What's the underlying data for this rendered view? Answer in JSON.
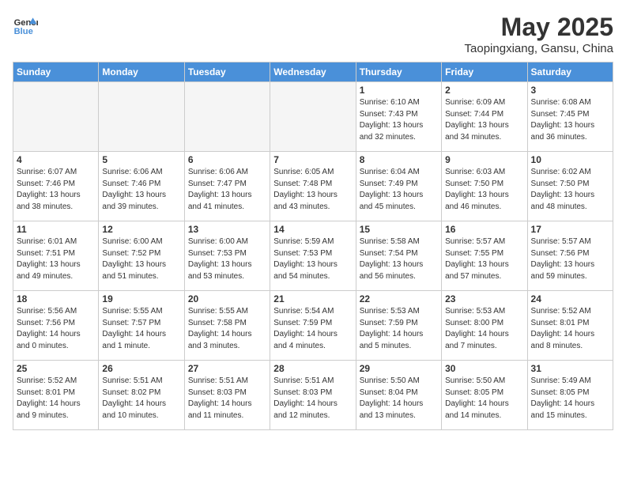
{
  "header": {
    "logo_general": "General",
    "logo_blue": "Blue",
    "month": "May 2025",
    "location": "Taopingxiang, Gansu, China"
  },
  "days_of_week": [
    "Sunday",
    "Monday",
    "Tuesday",
    "Wednesday",
    "Thursday",
    "Friday",
    "Saturday"
  ],
  "weeks": [
    [
      {
        "day": "",
        "info": ""
      },
      {
        "day": "",
        "info": ""
      },
      {
        "day": "",
        "info": ""
      },
      {
        "day": "",
        "info": ""
      },
      {
        "day": "1",
        "info": "Sunrise: 6:10 AM\nSunset: 7:43 PM\nDaylight: 13 hours\nand 32 minutes."
      },
      {
        "day": "2",
        "info": "Sunrise: 6:09 AM\nSunset: 7:44 PM\nDaylight: 13 hours\nand 34 minutes."
      },
      {
        "day": "3",
        "info": "Sunrise: 6:08 AM\nSunset: 7:45 PM\nDaylight: 13 hours\nand 36 minutes."
      }
    ],
    [
      {
        "day": "4",
        "info": "Sunrise: 6:07 AM\nSunset: 7:46 PM\nDaylight: 13 hours\nand 38 minutes."
      },
      {
        "day": "5",
        "info": "Sunrise: 6:06 AM\nSunset: 7:46 PM\nDaylight: 13 hours\nand 39 minutes."
      },
      {
        "day": "6",
        "info": "Sunrise: 6:06 AM\nSunset: 7:47 PM\nDaylight: 13 hours\nand 41 minutes."
      },
      {
        "day": "7",
        "info": "Sunrise: 6:05 AM\nSunset: 7:48 PM\nDaylight: 13 hours\nand 43 minutes."
      },
      {
        "day": "8",
        "info": "Sunrise: 6:04 AM\nSunset: 7:49 PM\nDaylight: 13 hours\nand 45 minutes."
      },
      {
        "day": "9",
        "info": "Sunrise: 6:03 AM\nSunset: 7:50 PM\nDaylight: 13 hours\nand 46 minutes."
      },
      {
        "day": "10",
        "info": "Sunrise: 6:02 AM\nSunset: 7:50 PM\nDaylight: 13 hours\nand 48 minutes."
      }
    ],
    [
      {
        "day": "11",
        "info": "Sunrise: 6:01 AM\nSunset: 7:51 PM\nDaylight: 13 hours\nand 49 minutes."
      },
      {
        "day": "12",
        "info": "Sunrise: 6:00 AM\nSunset: 7:52 PM\nDaylight: 13 hours\nand 51 minutes."
      },
      {
        "day": "13",
        "info": "Sunrise: 6:00 AM\nSunset: 7:53 PM\nDaylight: 13 hours\nand 53 minutes."
      },
      {
        "day": "14",
        "info": "Sunrise: 5:59 AM\nSunset: 7:53 PM\nDaylight: 13 hours\nand 54 minutes."
      },
      {
        "day": "15",
        "info": "Sunrise: 5:58 AM\nSunset: 7:54 PM\nDaylight: 13 hours\nand 56 minutes."
      },
      {
        "day": "16",
        "info": "Sunrise: 5:57 AM\nSunset: 7:55 PM\nDaylight: 13 hours\nand 57 minutes."
      },
      {
        "day": "17",
        "info": "Sunrise: 5:57 AM\nSunset: 7:56 PM\nDaylight: 13 hours\nand 59 minutes."
      }
    ],
    [
      {
        "day": "18",
        "info": "Sunrise: 5:56 AM\nSunset: 7:56 PM\nDaylight: 14 hours\nand 0 minutes."
      },
      {
        "day": "19",
        "info": "Sunrise: 5:55 AM\nSunset: 7:57 PM\nDaylight: 14 hours\nand 1 minute."
      },
      {
        "day": "20",
        "info": "Sunrise: 5:55 AM\nSunset: 7:58 PM\nDaylight: 14 hours\nand 3 minutes."
      },
      {
        "day": "21",
        "info": "Sunrise: 5:54 AM\nSunset: 7:59 PM\nDaylight: 14 hours\nand 4 minutes."
      },
      {
        "day": "22",
        "info": "Sunrise: 5:53 AM\nSunset: 7:59 PM\nDaylight: 14 hours\nand 5 minutes."
      },
      {
        "day": "23",
        "info": "Sunrise: 5:53 AM\nSunset: 8:00 PM\nDaylight: 14 hours\nand 7 minutes."
      },
      {
        "day": "24",
        "info": "Sunrise: 5:52 AM\nSunset: 8:01 PM\nDaylight: 14 hours\nand 8 minutes."
      }
    ],
    [
      {
        "day": "25",
        "info": "Sunrise: 5:52 AM\nSunset: 8:01 PM\nDaylight: 14 hours\nand 9 minutes."
      },
      {
        "day": "26",
        "info": "Sunrise: 5:51 AM\nSunset: 8:02 PM\nDaylight: 14 hours\nand 10 minutes."
      },
      {
        "day": "27",
        "info": "Sunrise: 5:51 AM\nSunset: 8:03 PM\nDaylight: 14 hours\nand 11 minutes."
      },
      {
        "day": "28",
        "info": "Sunrise: 5:51 AM\nSunset: 8:03 PM\nDaylight: 14 hours\nand 12 minutes."
      },
      {
        "day": "29",
        "info": "Sunrise: 5:50 AM\nSunset: 8:04 PM\nDaylight: 14 hours\nand 13 minutes."
      },
      {
        "day": "30",
        "info": "Sunrise: 5:50 AM\nSunset: 8:05 PM\nDaylight: 14 hours\nand 14 minutes."
      },
      {
        "day": "31",
        "info": "Sunrise: 5:49 AM\nSunset: 8:05 PM\nDaylight: 14 hours\nand 15 minutes."
      }
    ]
  ]
}
